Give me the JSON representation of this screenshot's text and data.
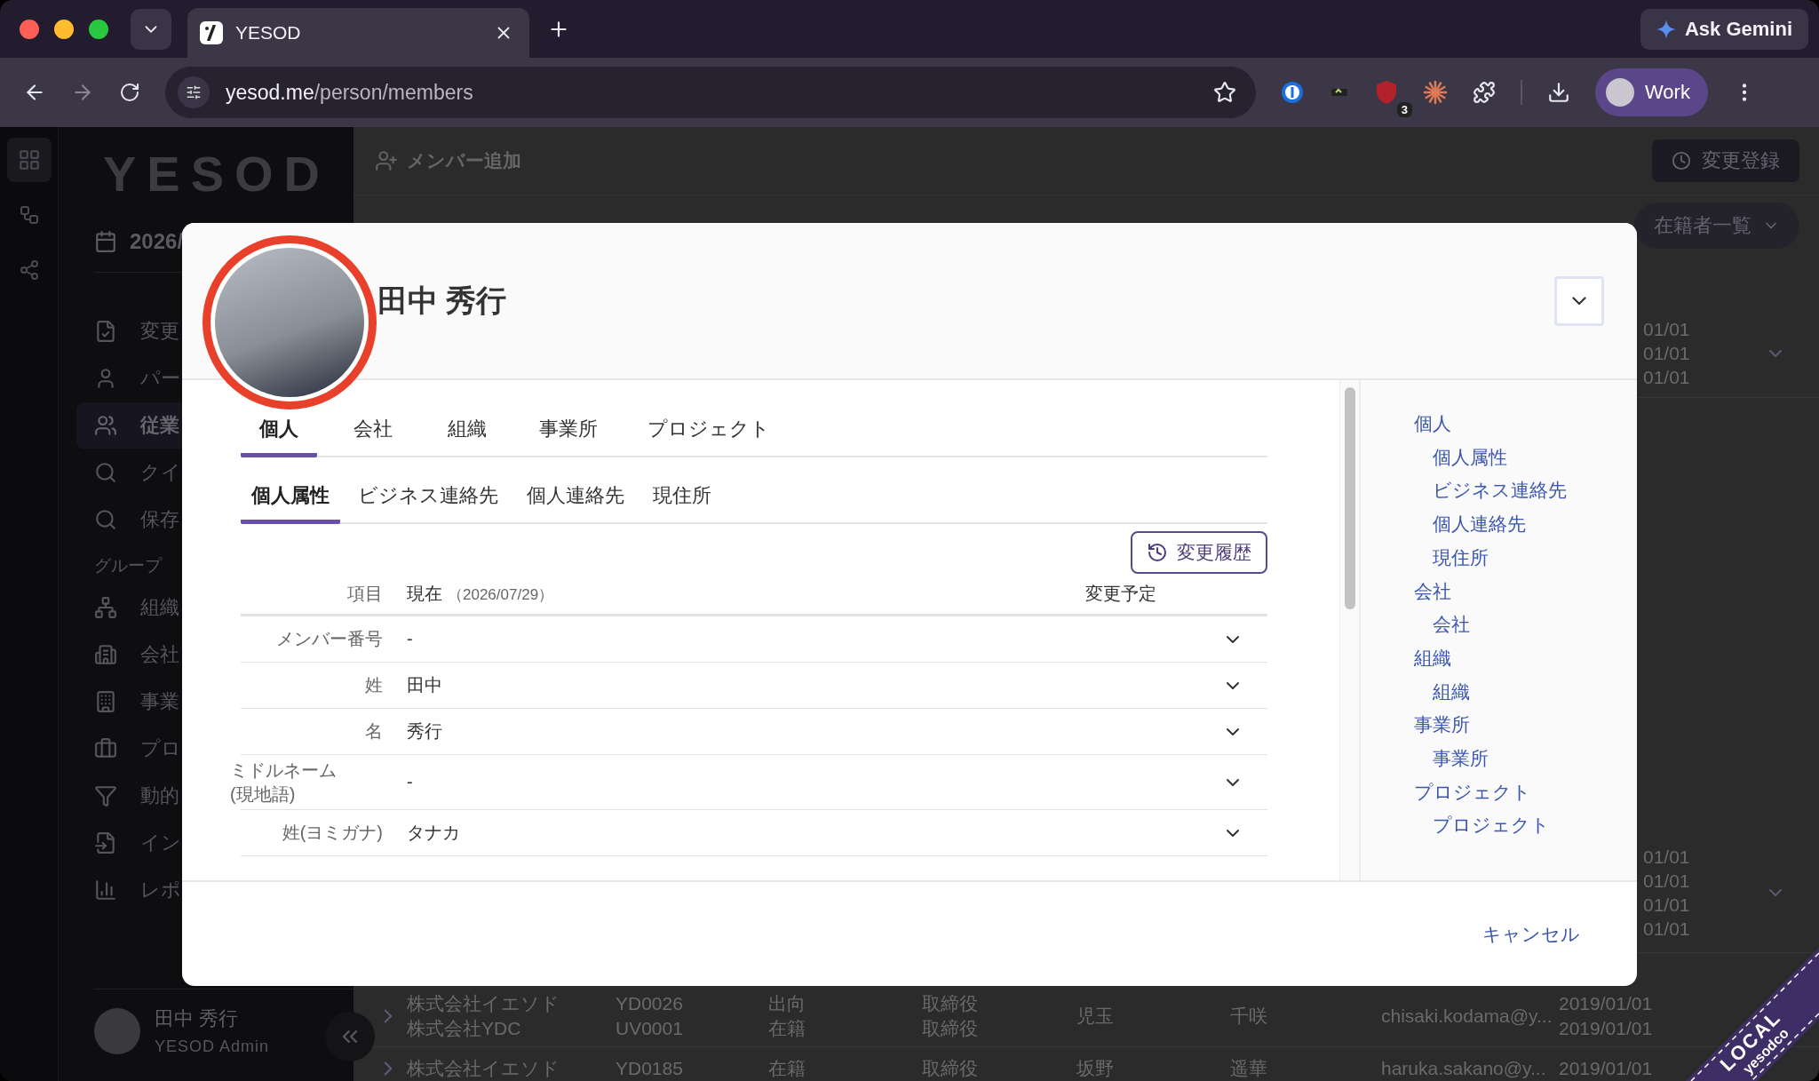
{
  "browser": {
    "tab": {
      "title": "YESOD"
    },
    "address": {
      "host": "yesod.me",
      "path": "/person/members"
    },
    "gemini_button": "Ask Gemini",
    "extension_badge": "3",
    "profile": "Work"
  },
  "sidebar": {
    "logo": "YESOD",
    "date": "2026/",
    "items": [
      {
        "kind": "item",
        "label": "変更",
        "selected": false
      },
      {
        "kind": "item",
        "label": "パー",
        "selected": false
      },
      {
        "kind": "item",
        "label": "従業",
        "selected": true
      },
      {
        "kind": "item",
        "label": "クイ",
        "selected": false
      },
      {
        "kind": "item",
        "label": "保存",
        "selected": false
      },
      {
        "kind": "heading",
        "label": "グループ"
      },
      {
        "kind": "item",
        "label": "組織",
        "selected": false
      },
      {
        "kind": "item",
        "label": "会社",
        "selected": false
      },
      {
        "kind": "item",
        "label": "事業",
        "selected": false
      },
      {
        "kind": "item",
        "label": "プロ",
        "selected": false
      },
      {
        "kind": "item",
        "label": "動的",
        "selected": false
      },
      {
        "kind": "item",
        "label": "イン",
        "selected": false
      },
      {
        "kind": "item",
        "label": "レポ",
        "selected": false
      }
    ],
    "user": {
      "name": "田中 秀行",
      "role": "YESOD Admin"
    }
  },
  "main": {
    "add_member": "メンバー追加",
    "register_button": "変更登録",
    "view_select": "在籍者一覧",
    "date_fragments_top": [
      "01/01",
      "01/01",
      "01/01"
    ],
    "date_fragments_bottom": [
      "01/01",
      "01/01",
      "01/01",
      "01/01"
    ],
    "rows": [
      {
        "company": [
          "株式会社イエソド",
          "株式会社YDC"
        ],
        "code": [
          "YD0026",
          "UV0001"
        ],
        "status": [
          "出向",
          "在籍"
        ],
        "role": [
          "取締役",
          "取締役"
        ],
        "last_name": "児玉",
        "first_name": "千咲",
        "email": "chisaki.kodama@y...",
        "joined": [
          "2019/01/01",
          "2019/01/01"
        ]
      },
      {
        "company": [
          "株式会社イエソド"
        ],
        "code": [
          "YD0185"
        ],
        "status": [
          "在籍"
        ],
        "role": [
          "取締役"
        ],
        "last_name": "坂野",
        "first_name": "遥華",
        "email": "haruka.sakano@y...",
        "joined": [
          "2019/01/01"
        ]
      }
    ]
  },
  "modal": {
    "person_name": "田中 秀行",
    "tabs": [
      {
        "label": "個人",
        "selected": true
      },
      {
        "label": "会社",
        "selected": false
      },
      {
        "label": "組織",
        "selected": false
      },
      {
        "label": "事業所",
        "selected": false
      },
      {
        "label": "プロジェクト",
        "selected": false
      }
    ],
    "subtabs": [
      {
        "label": "個人属性",
        "selected": true
      },
      {
        "label": "ビジネス連絡先",
        "selected": false
      },
      {
        "label": "個人連絡先",
        "selected": false
      },
      {
        "label": "現住所",
        "selected": false
      }
    ],
    "history_button": "変更履歴",
    "table_header": {
      "item": "項目",
      "current": "現在",
      "current_date": "（2026/07/29）",
      "planned": "変更予定"
    },
    "fields": [
      {
        "label_lines": [
          "メンバー番号"
        ],
        "value": "-"
      },
      {
        "label_lines": [
          "姓"
        ],
        "value": "田中"
      },
      {
        "label_lines": [
          "名"
        ],
        "value": "秀行"
      },
      {
        "label_lines": [
          "ミドルネーム",
          "(現地語)"
        ],
        "value": "-"
      },
      {
        "label_lines": [
          "姓(ヨミガナ)"
        ],
        "value": "タナカ"
      }
    ],
    "toc": [
      {
        "label": "個人",
        "children": [
          {
            "label": "個人属性"
          },
          {
            "label": "ビジネス連絡先"
          },
          {
            "label": "個人連絡先"
          },
          {
            "label": "現住所"
          }
        ]
      },
      {
        "label": "会社",
        "children": [
          {
            "label": "会社"
          }
        ]
      },
      {
        "label": "組織",
        "children": [
          {
            "label": "組織"
          }
        ]
      },
      {
        "label": "事業所",
        "children": [
          {
            "label": "事業所"
          }
        ]
      },
      {
        "label": "プロジェクト",
        "children": [
          {
            "label": "プロジェクト"
          }
        ]
      }
    ],
    "cancel_button": "キャンセル"
  },
  "ribbon": {
    "line_1": "LOCAL",
    "line_2": "yesodco"
  }
}
